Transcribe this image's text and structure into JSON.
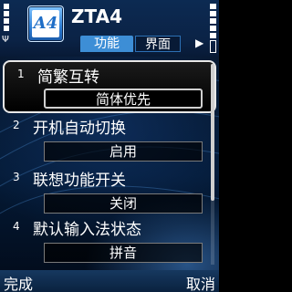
{
  "app": {
    "title": "ZTA4",
    "icon_text": "A4",
    "tabs": [
      {
        "label": "功能",
        "active": true
      },
      {
        "label": "界面",
        "active": false
      }
    ],
    "tab_arrows": "▶"
  },
  "items": [
    {
      "number": "1",
      "label": "简繁互转",
      "value": "简体优先",
      "selected": true
    },
    {
      "number": "2",
      "label": "开机自动切换",
      "value": "启用",
      "selected": false
    },
    {
      "number": "3",
      "label": "联想功能开关",
      "value": "关闭",
      "selected": false
    },
    {
      "number": "4",
      "label": "默认输入法状态",
      "value": "拼音",
      "selected": false
    }
  ],
  "softkeys": {
    "left": "完成",
    "right": "取消"
  },
  "colors": {
    "tab_active": "#3d8ed6",
    "status_bg": "#0b2346",
    "selection_border": "#e8e8e8"
  }
}
